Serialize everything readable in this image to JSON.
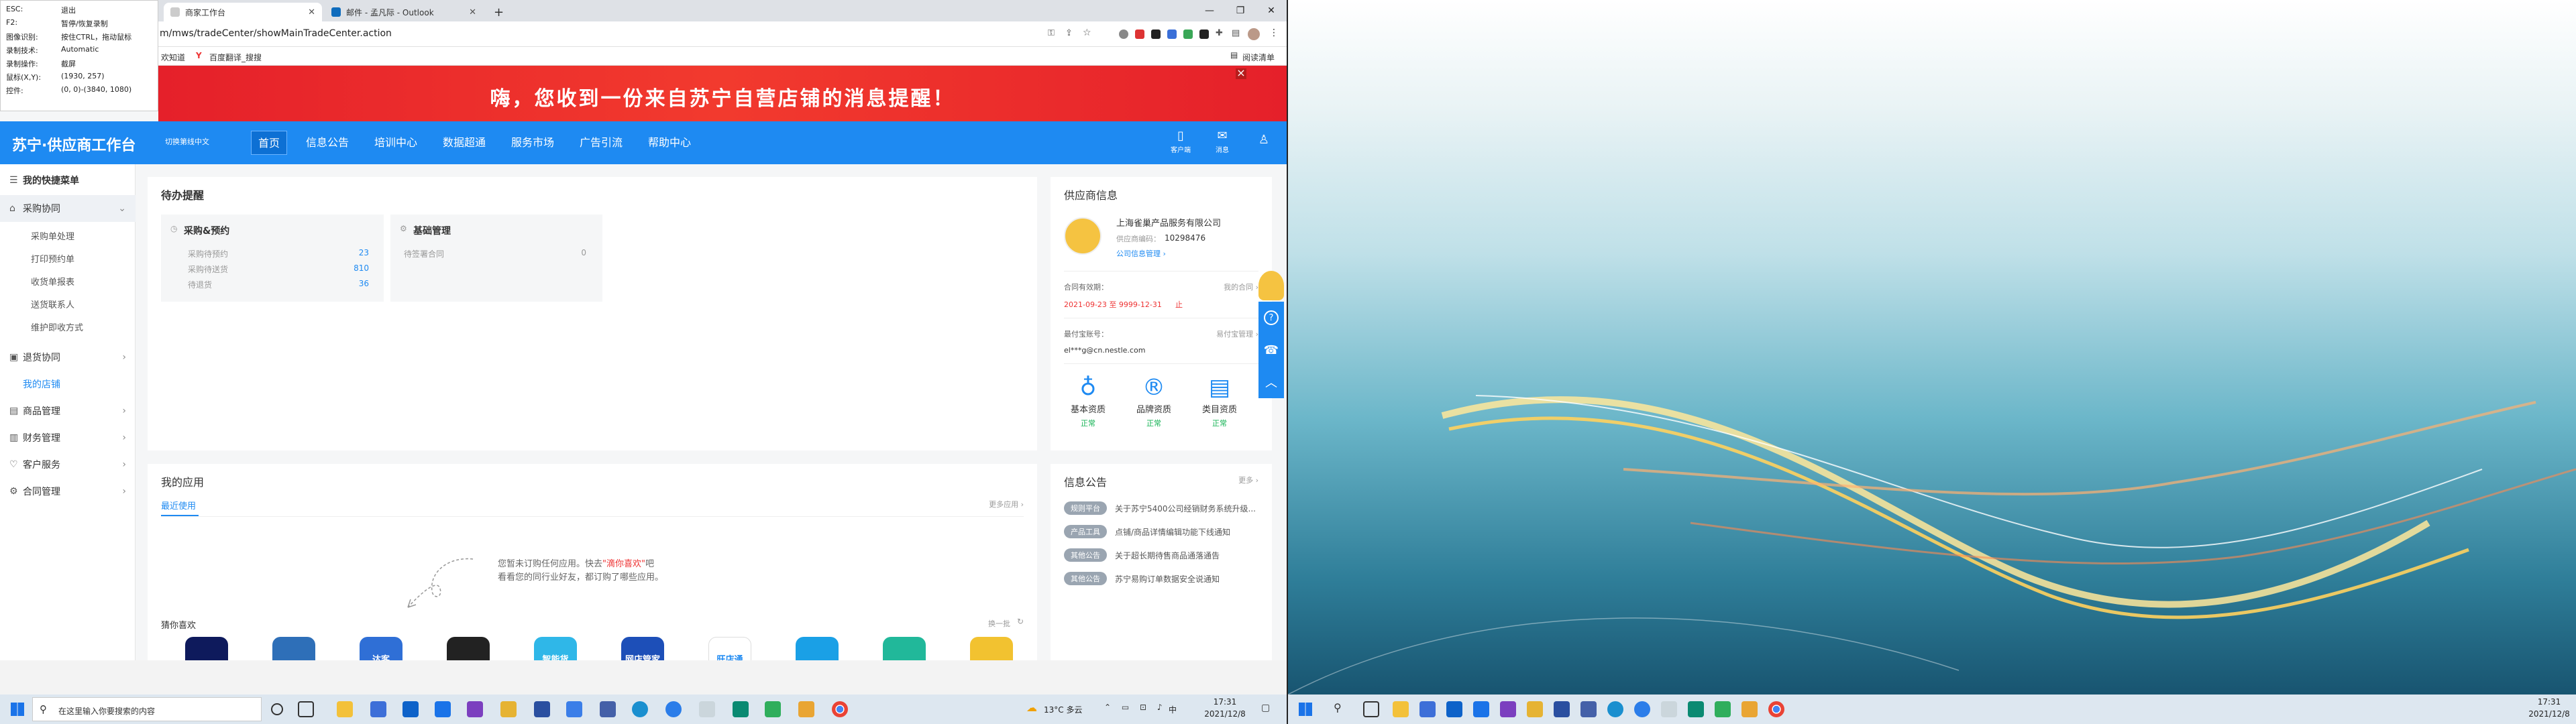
{
  "browser": {
    "tabs": [
      {
        "label": "商家工作台",
        "active": true
      },
      {
        "label": "邮件 - 孟凡际 - Outlook",
        "active": false
      }
    ],
    "new_tab_label": "+",
    "window_controls": {
      "minimize": "—",
      "restore": "❐",
      "close": "✕"
    },
    "url": "m/mws/tradeCenter/showMainTradeCenter.action",
    "bookmarks": [
      {
        "label": "欢知道"
      },
      {
        "label": "百度翻译_搜搜"
      }
    ],
    "reading_list": "阅读清单"
  },
  "overlay": {
    "rows": [
      {
        "key": "ESC:",
        "value": "退出"
      },
      {
        "key": "F2:",
        "value": "暂停/恢复录制"
      },
      {
        "key": "图像识别:",
        "value": "按住CTRL，拖动鼠标"
      },
      {
        "key": "录制技术:",
        "value": "Automatic"
      },
      {
        "key": "录制操作:",
        "value": "截屏"
      },
      {
        "key": "鼠标(X,Y):",
        "value": "(1930, 257)"
      },
      {
        "key": "控件:",
        "value": "(0, 0)-(3840, 1080)"
      }
    ]
  },
  "banner": {
    "text": "嗨，您收到一份来自苏宁自营店铺的消息提醒！",
    "close": "×"
  },
  "nav": {
    "logo": "苏宁·供应商工作台",
    "subtitle": "切换第线中文",
    "items": [
      {
        "label": "首页",
        "active": true
      },
      {
        "label": "信息公告",
        "active": false
      },
      {
        "label": "培训中心",
        "active": false
      },
      {
        "label": "数据超通",
        "active": false
      },
      {
        "label": "服务市场",
        "active": false
      },
      {
        "label": "广告引流",
        "active": false
      },
      {
        "label": "帮助中心",
        "active": false
      }
    ],
    "right_icons": [
      {
        "label": "客户端",
        "icon": "mobile-icon",
        "glyph": "▯"
      },
      {
        "label": "消息",
        "icon": "mail-icon",
        "glyph": "✉"
      }
    ],
    "user_glyph": "♙"
  },
  "sidebar": {
    "header": "我的快捷菜单",
    "items": [
      {
        "label": "采购协同",
        "glyph": "⌂",
        "expanded": true,
        "children": [
          "采购单处理",
          "打印预约单",
          "收货单报表",
          "送货联系人",
          "维护即收方式"
        ]
      },
      {
        "label": "退货协同",
        "glyph": "▣",
        "expanded": false,
        "children": []
      },
      {
        "label": "我的店铺",
        "glyph": "",
        "expanded": false,
        "children": [],
        "highlight": true
      },
      {
        "label": "商品管理",
        "glyph": "▤",
        "expanded": false,
        "children": []
      },
      {
        "label": "财务管理",
        "glyph": "▥",
        "expanded": false,
        "children": []
      },
      {
        "label": "客户服务",
        "glyph": "♡",
        "expanded": false,
        "children": []
      },
      {
        "label": "合同管理",
        "glyph": "⚙",
        "expanded": false,
        "children": []
      }
    ]
  },
  "todo": {
    "title": "待办提醒",
    "cards": [
      {
        "title": "采购&预约",
        "rows": [
          {
            "label": "采购待预约",
            "value": "23"
          },
          {
            "label": "采购待送货",
            "value": "810"
          },
          {
            "label": "待退货",
            "value": "36"
          }
        ]
      },
      {
        "title": "基础管理",
        "rows": [
          {
            "label": "待签署合同",
            "value": "0"
          }
        ]
      }
    ]
  },
  "supplier": {
    "title": "供应商信息",
    "company": "上海雀巢产品服务有限公司",
    "code_label": "供应商编码：",
    "code": "10298476",
    "manage_link": "公司信息管理 ›",
    "contract_label": "合同有效期：",
    "contract_link": "我的合同 ›",
    "contract_dates": "2021-09-23 至 9999-12-31",
    "contract_suffix": "止",
    "payee_label": "最付宝账号：",
    "payee_link": "易付宝管理 ›",
    "payee": "el***g@cn.nestle.com",
    "certs": [
      {
        "label": "基本资质",
        "status": "正常",
        "glyph": "♁"
      },
      {
        "label": "品牌资质",
        "status": "正常",
        "glyph": "®"
      },
      {
        "label": "类目资质",
        "status": "正常",
        "glyph": "▤"
      }
    ]
  },
  "apps": {
    "title": "我的应用",
    "more": "更多应用 ›",
    "tab": "最近使用",
    "empty_line1_pre": "您暂未订购任何应用。快去",
    "empty_line1_link": "\"滴你喜欢\"",
    "empty_line1_post": "吧",
    "empty_line2": "看看您的同行业好友，都订购了哪些应用。",
    "guess_title": "猜你喜欢",
    "refresh": "换一批",
    "icon_colors": [
      "#0e1a5c",
      "#2e6fb8",
      "#2f6fd6",
      "#222",
      "#2fb7e8",
      "#1d4fb8",
      "#ffffff",
      "#1aa0e6",
      "#21b89a",
      "#f2c230"
    ],
    "icon_texts": [
      "",
      "",
      "达客",
      "",
      "智能货",
      "网店管家",
      "旺店通",
      "",
      "",
      ""
    ]
  },
  "notices": {
    "title": "信息公告",
    "more": "更多 ›",
    "items": [
      {
        "badge": "规则平台",
        "text": "关于苏宁5400公司经销财务系统升级..."
      },
      {
        "badge": "产品工具",
        "text": "点铺/商品详情编辑功能下线通知"
      },
      {
        "badge": "其他公告",
        "text": "关于超长期待售商品通落通告"
      },
      {
        "badge": "其他公告",
        "text": "苏宁易购订单数据安全说通知"
      }
    ]
  },
  "float_buttons": [
    "?",
    "☎",
    "︿"
  ],
  "taskbar_left": {
    "search_placeholder": "在这里输入你要搜索的内容",
    "weather": "13°C  多云",
    "time": "17:31",
    "date": "2021/12/8",
    "ime": "中"
  },
  "taskbar_right": {
    "time": "17:31",
    "date": "2021/12/8"
  }
}
